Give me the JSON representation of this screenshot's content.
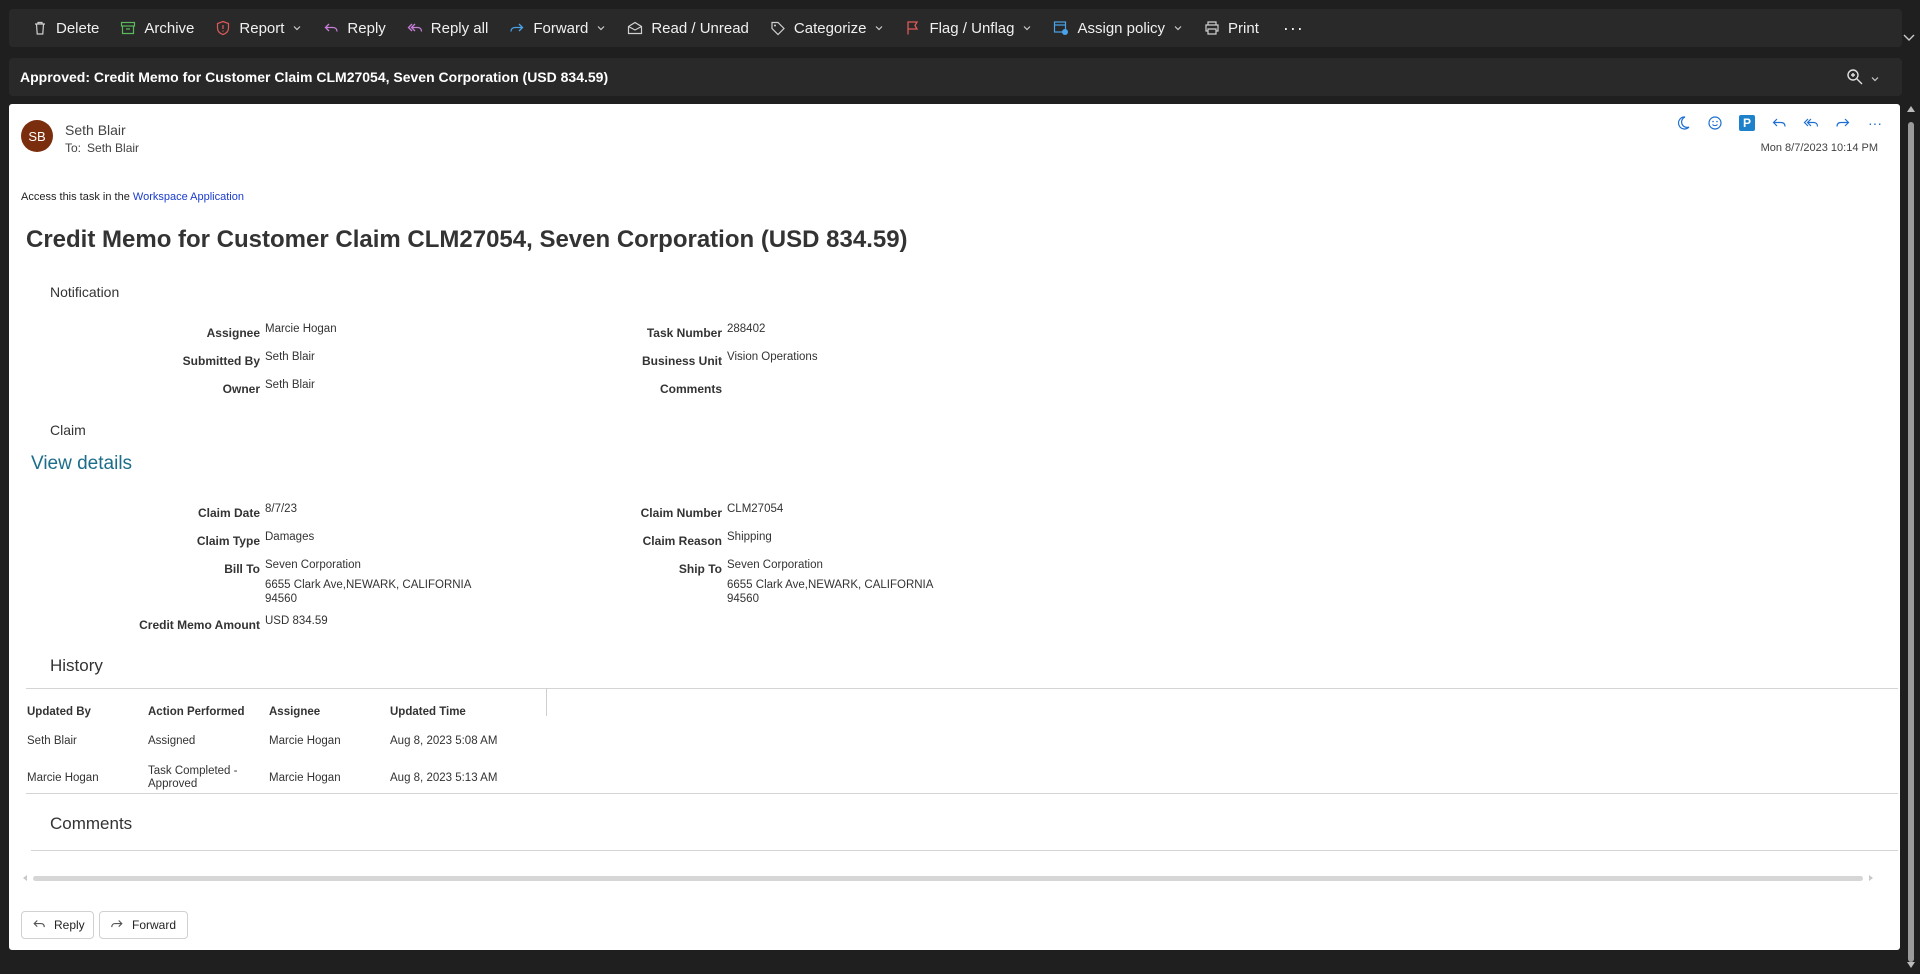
{
  "toolbar": {
    "delete": "Delete",
    "archive": "Archive",
    "report": "Report",
    "reply": "Reply",
    "reply_all": "Reply all",
    "forward": "Forward",
    "read_unread": "Read / Unread",
    "categorize": "Categorize",
    "flag_unflag": "Flag / Unflag",
    "assign_policy": "Assign policy",
    "print": "Print",
    "more": "···"
  },
  "subject": "Approved: Credit Memo for Customer Claim CLM27054, Seven Corporation (USD 834.59)",
  "message": {
    "avatar_initials": "SB",
    "sender": "Seth Blair",
    "to_label": "To:",
    "to": "Seth Blair",
    "date": "Mon 8/7/2023 10:14 PM",
    "more": "···",
    "plugin_letter": "P"
  },
  "body": {
    "access_text": "Access this task in the",
    "access_link": "Workspace Application",
    "title": "Credit Memo for Customer Claim CLM27054, Seven Corporation (USD 834.59)",
    "notification_label": "Notification",
    "notification": {
      "assignee_label": "Assignee",
      "assignee": "Marcie Hogan",
      "submitted_by_label": "Submitted By",
      "submitted_by": "Seth Blair",
      "owner_label": "Owner",
      "owner": "Seth Blair",
      "task_number_label": "Task Number",
      "task_number": "288402",
      "business_unit_label": "Business Unit",
      "business_unit": "Vision Operations",
      "comments_label": "Comments"
    },
    "claim_label": "Claim",
    "view_details": "View details",
    "claim": {
      "claim_date_label": "Claim Date",
      "claim_date": "8/7/23",
      "claim_type_label": "Claim Type",
      "claim_type": "Damages",
      "bill_to_label": "Bill To",
      "bill_to_name": "Seven Corporation",
      "bill_to_addr1": "6655 Clark Ave,NEWARK, CALIFORNIA",
      "bill_to_addr2": "94560",
      "credit_memo_amount_label": "Credit Memo Amount",
      "credit_memo_amount": "USD 834.59",
      "claim_number_label": "Claim Number",
      "claim_number": "CLM27054",
      "claim_reason_label": "Claim Reason",
      "claim_reason": "Shipping",
      "ship_to_label": "Ship To",
      "ship_to_name": "Seven Corporation",
      "ship_to_addr1": "6655 Clark Ave,NEWARK, CALIFORNIA",
      "ship_to_addr2": "94560"
    },
    "history_label": "History",
    "history": {
      "headers": [
        "Updated By",
        "Action Performed",
        "Assignee",
        "Updated Time"
      ],
      "rows": [
        [
          "Seth Blair",
          "Assigned",
          "Marcie Hogan",
          "Aug 8, 2023 5:08 AM"
        ],
        [
          "Marcie Hogan",
          "Task Completed - Approved",
          "Marcie Hogan",
          "Aug 8, 2023 5:13 AM"
        ]
      ],
      "row2_action_line1": "Task Completed -",
      "row2_action_line2": "Approved"
    },
    "comments_label": "Comments"
  },
  "bottom": {
    "reply": "Reply",
    "forward": "Forward"
  }
}
